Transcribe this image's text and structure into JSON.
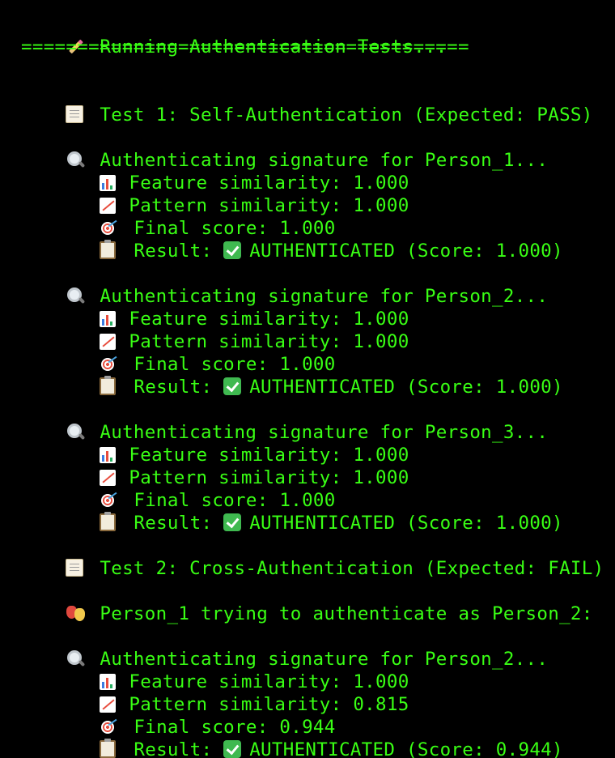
{
  "header": {
    "title": "Running Authentication Tests...",
    "rule": "========================================"
  },
  "tests": {
    "test1": {
      "heading": "Test 1: Self-Authentication (Expected: PASS)",
      "blocks": [
        {
          "header": "Authenticating signature for Person_1...",
          "feature": "Feature similarity: 1.000",
          "pattern": "Pattern similarity: 1.000",
          "final": "Final score: 1.000",
          "result_prefix": "Result:",
          "result_text": "AUTHENTICATED (Score: 1.000)"
        },
        {
          "header": "Authenticating signature for Person_2...",
          "feature": "Feature similarity: 1.000",
          "pattern": "Pattern similarity: 1.000",
          "final": "Final score: 1.000",
          "result_prefix": "Result:",
          "result_text": "AUTHENTICATED (Score: 1.000)"
        },
        {
          "header": "Authenticating signature for Person_3...",
          "feature": "Feature similarity: 1.000",
          "pattern": "Pattern similarity: 1.000",
          "final": "Final score: 1.000",
          "result_prefix": "Result:",
          "result_text": "AUTHENTICATED (Score: 1.000)"
        }
      ]
    },
    "test2": {
      "heading": "Test 2: Cross-Authentication (Expected: FAIL)",
      "attempt": "Person_1 trying to authenticate as Person_2:",
      "blocks": [
        {
          "header": "Authenticating signature for Person_2...",
          "feature": "Feature similarity: 1.000",
          "pattern": "Pattern similarity: 0.815",
          "final": "Final score: 0.944",
          "result_prefix": "Result:",
          "result_text": "AUTHENTICATED (Score: 0.944)"
        }
      ]
    }
  },
  "colors": {
    "background": "#000000",
    "text": "#39ff14"
  }
}
